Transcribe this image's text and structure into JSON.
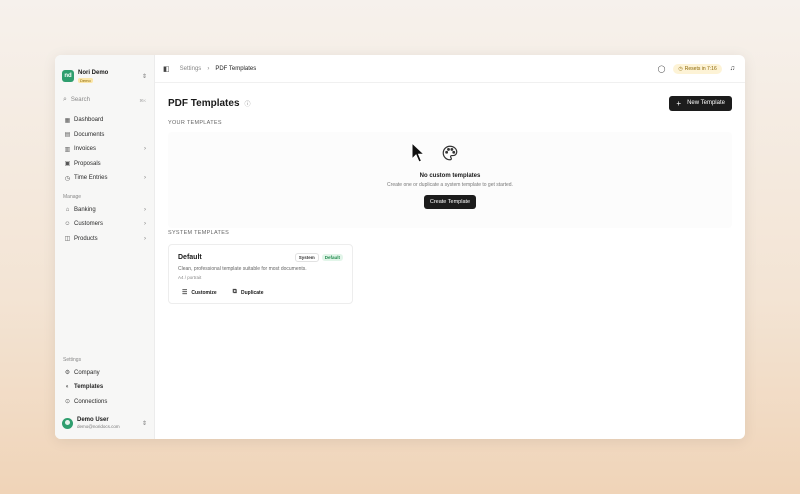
{
  "sidebar": {
    "org": {
      "logo_text": "nd",
      "name": "Nori Demo",
      "badge": "Demo"
    },
    "search": {
      "placeholder": "Search",
      "shortcut": "⌘K"
    },
    "items": [
      {
        "label": "Dashboard"
      },
      {
        "label": "Documents"
      },
      {
        "label": "Invoices"
      },
      {
        "label": "Proposals"
      },
      {
        "label": "Time Entries"
      }
    ],
    "manage_label": "Manage",
    "manage_items": [
      {
        "label": "Banking"
      },
      {
        "label": "Customers"
      },
      {
        "label": "Products"
      }
    ],
    "settings_label": "Settings",
    "settings_items": [
      {
        "label": "Company"
      },
      {
        "label": "Templates"
      },
      {
        "label": "Connections"
      }
    ],
    "user": {
      "name": "Demo User",
      "email": "demo@noridocs.com"
    }
  },
  "topbar": {
    "breadcrumb": [
      "Settings",
      "PDF Templates"
    ],
    "reset_text": "Resets in 7:16"
  },
  "page": {
    "title": "PDF Templates",
    "new_button": "New Template",
    "your_templates_header": "YOUR TEMPLATES",
    "empty_title": "No custom templates",
    "empty_desc": "Create one or duplicate a system template to get started.",
    "create_button": "Create Template",
    "system_templates_header": "SYSTEM TEMPLATES",
    "cards": [
      {
        "title": "Default",
        "badge_system": "System",
        "badge_default": "Default",
        "description": "Clean, professional template suitable for most documents.",
        "meta": "A4 / portrait",
        "actions": [
          "Customize",
          "Duplicate"
        ]
      }
    ]
  },
  "colors": {
    "accent": "#1c1c1c",
    "brand": "#2f9e6e",
    "default_badge": "#1f8a4c",
    "reset_pill": "#fdf3d6"
  }
}
